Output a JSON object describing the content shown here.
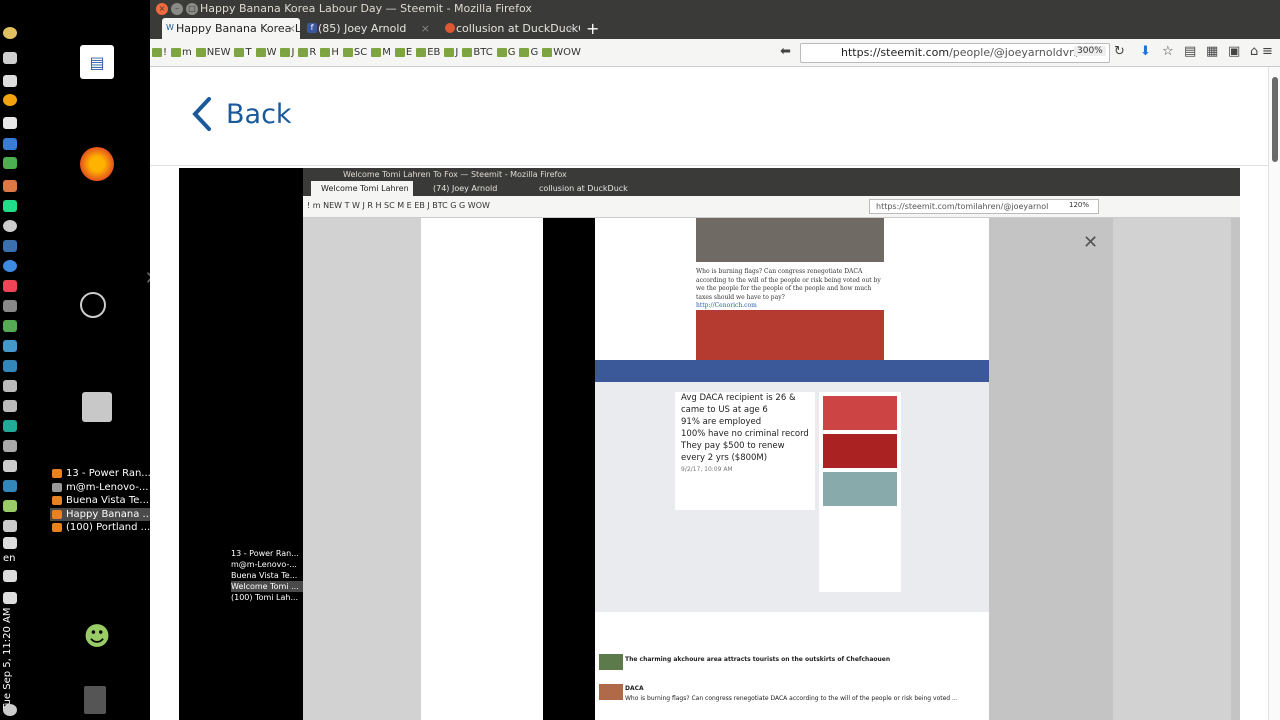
{
  "system": {
    "clock": "Tue Sep 5, 11:20 AM",
    "language": "en"
  },
  "desktop": {
    "tasks": [
      {
        "label": "13 - Power Ran..."
      },
      {
        "label": "m@m-Lenovo-..."
      },
      {
        "label": "Buena Vista Te..."
      },
      {
        "label": "Happy Banana ...",
        "active": true
      },
      {
        "label": "(100) Portland ..."
      }
    ]
  },
  "window": {
    "title": "Happy Banana Korea Labour Day — Steemit - Mozilla Firefox",
    "tabs": [
      {
        "label": "Happy Banana Korea L",
        "icon": "steemit-icon",
        "active": true
      },
      {
        "label": "(85) Joey Arnold",
        "icon": "facebook-icon",
        "active": false
      },
      {
        "label": "collusion at DuckDuckG",
        "icon": "duckduckgo-icon",
        "active": false
      }
    ],
    "bookmarks": [
      "!",
      "m",
      "NEW",
      "T",
      "W",
      "J",
      "R",
      "H",
      "SC",
      "M",
      "E",
      "EB",
      "J",
      "BTC",
      "G",
      "G",
      "WOW"
    ],
    "url_host": "https://steemit.com",
    "url_path": "/people/@joeyarnoldvn/h",
    "zoom": "300%"
  },
  "page": {
    "back_label": "Back"
  },
  "nested": {
    "title": "Welcome Tomi Lahren To Fox — Steemit - Mozilla Firefox",
    "tabs": [
      {
        "label": "Welcome Tomi Lahren"
      },
      {
        "label": "(74) Joey Arnold"
      },
      {
        "label": "collusion at DuckDuck"
      }
    ],
    "bookmarks": "! m NEW T W J R H SC M E EB J BTC G G WOW",
    "url": "https://steemit.com/tomilahren/@joeyarnol",
    "zoom": "120%",
    "tasks": [
      "13 - Power Ran...",
      "m@m-Lenovo-...",
      "Buena Vista Te...",
      "Welcome Tomi ...",
      "(100) Tomi Lah..."
    ],
    "post_text": "Who is burning flags? Can congress renegotiate DACA according to the will of the people or risk being voted out by we the people for the people of the people and how much taxes should we have to pay?",
    "post_link": "http://Cenorich.com",
    "daca_lines": [
      "Avg DACA recipient is 26 & came to US at age 6",
      "91% are employed",
      "100% have no criminal record",
      "They pay $500 to renew every 2 yrs ($800M)"
    ],
    "daca_date": "9/2/17, 10:09 AM",
    "steemit_rows": [
      {
        "title": "The charming akchoure area attracts tourists on the outskirts of Chefchaouen"
      },
      {
        "title": "DACA",
        "text": "Who is burning flags? Can congress renegotiate DACA according to the will of the people or risk being voted ..."
      }
    ]
  }
}
